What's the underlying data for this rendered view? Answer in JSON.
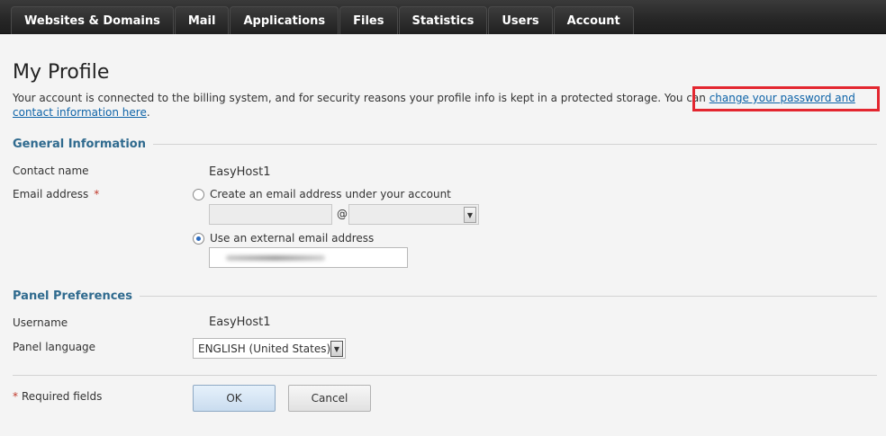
{
  "nav": {
    "tabs": [
      {
        "label": "Websites & Domains"
      },
      {
        "label": "Mail"
      },
      {
        "label": "Applications"
      },
      {
        "label": "Files"
      },
      {
        "label": "Statistics"
      },
      {
        "label": "Users"
      },
      {
        "label": "Account"
      }
    ]
  },
  "page": {
    "title": "My Profile",
    "intro_text": "Your account is connected to the billing system, and for security reasons your profile info is kept in a protected storage. You can ",
    "intro_link": "change your password and contact information here",
    "intro_end": "."
  },
  "general": {
    "section_title": "General Information",
    "contact_label": "Contact name",
    "contact_value": "EasyHost1",
    "email_label": "Email address",
    "required_mark": "*",
    "option_create": "Create an email address under your account",
    "option_external": "Use an external email address",
    "at_sign": "@",
    "selected_option": "external"
  },
  "preferences": {
    "section_title": "Panel Preferences",
    "username_label": "Username",
    "username_value": "EasyHost1",
    "language_label": "Panel language",
    "language_value": "ENGLISH (United States)"
  },
  "footer": {
    "required_mark": "*",
    "required_text": "Required fields",
    "ok_label": "OK",
    "cancel_label": "Cancel"
  },
  "colors": {
    "accent": "#2f6a8e",
    "link": "#0d63a8",
    "highlight": "#e3262f"
  }
}
